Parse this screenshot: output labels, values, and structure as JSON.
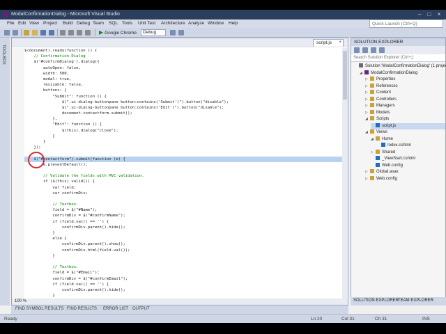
{
  "window": {
    "title": "ModalConfirmationDialog - Microsoft Visual Studio"
  },
  "menu": {
    "items": [
      "File",
      "Edit",
      "View",
      "Project",
      "Build",
      "Debug",
      "Team",
      "SQL",
      "Tools",
      "Unit Test",
      "Architecture",
      "Analyze",
      "Window",
      "Help"
    ],
    "quick_launch_placeholder": "Quick Launch (Ctrl+Q)"
  },
  "toolbar": {
    "run_label": "Google Chrome",
    "config": "Debug"
  },
  "left_panel": {
    "label": "TOOLBOX"
  },
  "editor": {
    "tab": "script.js",
    "zoom": "100 %",
    "lines": [
      {
        "t": "$(document).ready(function () {"
      },
      {
        "t": "    // Confirmation Dialog",
        "c": "c-com"
      },
      {
        "t": "    $('#confirmDialog').dialog({"
      },
      {
        "t": "        autoOpen: false,"
      },
      {
        "t": "        width: 500,"
      },
      {
        "t": "        modal: true,"
      },
      {
        "t": "        resizable: false,"
      },
      {
        "t": "        buttons: {"
      },
      {
        "t": "            \"Submit\": function () {"
      },
      {
        "t": "                $(\".ui-dialog-buttonpane button:contains('Submit')\").button(\"disable\");"
      },
      {
        "t": "                $(\".ui-dialog-buttonpane button:contains('Edit')\").button(\"disable\");"
      },
      {
        "t": "                document.contactform.submit();"
      },
      {
        "t": "            },"
      },
      {
        "t": "            \"Edit\": function () {"
      },
      {
        "t": "                $(this).dialog(\"close\");"
      },
      {
        "t": "            }"
      },
      {
        "t": "        }"
      },
      {
        "t": "    });"
      },
      {
        "t": ""
      },
      {
        "t": "    $(\"#contactform\").submit(function (e) {",
        "hl": true
      },
      {
        "t": "        e.preventDefault();"
      },
      {
        "t": ""
      },
      {
        "t": "        // Validate the fields with MVC validation.",
        "c": "c-com"
      },
      {
        "t": "        if ($(this).valid()) {"
      },
      {
        "t": "            var field;"
      },
      {
        "t": "            var confirmDiv;"
      },
      {
        "t": ""
      },
      {
        "t": "            // Textbox.",
        "c": "c-com"
      },
      {
        "t": "            field = $(\"#Name\");"
      },
      {
        "t": "            confirmDiv = $(\"#confirmName\");"
      },
      {
        "t": "            if (field.val() == '') {"
      },
      {
        "t": "                confirmDiv.parent().hide();"
      },
      {
        "t": "            }"
      },
      {
        "t": "            else {"
      },
      {
        "t": "                confirmDiv.parent().show();"
      },
      {
        "t": "                confirmDiv.html(field.val());"
      },
      {
        "t": "            }"
      },
      {
        "t": ""
      },
      {
        "t": "            // Textbox.",
        "c": "c-com"
      },
      {
        "t": "            field = $(\"#Email\");"
      },
      {
        "t": "            confirmDiv = $(\"#confirmEmail\");"
      },
      {
        "t": "            if (field.val() == '') {"
      },
      {
        "t": "                confirmDiv.parent().hide();"
      },
      {
        "t": "            }"
      }
    ]
  },
  "bottom_tabs": [
    "FIND SYMBOL RESULTS",
    "FIND RESULTS",
    "ERROR LIST",
    "OUTPUT"
  ],
  "solution_explorer": {
    "title": "SOLUTION EXPLORER",
    "search_placeholder": "Search Solution Explorer (Ctrl+;)",
    "nodes": [
      {
        "label": "Solution 'ModalConfirmationDialog' (1 project)",
        "depth": 0,
        "arrow": ""
      },
      {
        "label": "ModalConfirmationDialog",
        "depth": 1,
        "arrow": "◢"
      },
      {
        "label": "Properties",
        "depth": 2,
        "arrow": "▷"
      },
      {
        "label": "References",
        "depth": 2,
        "arrow": "▷"
      },
      {
        "label": "Content",
        "depth": 2,
        "arrow": "▷"
      },
      {
        "label": "Controllers",
        "depth": 2,
        "arrow": "▷"
      },
      {
        "label": "Managers",
        "depth": 2,
        "arrow": "▷"
      },
      {
        "label": "Models",
        "depth": 2,
        "arrow": "▷"
      },
      {
        "label": "Scripts",
        "depth": 2,
        "arrow": "◢"
      },
      {
        "label": "script.js",
        "depth": 3,
        "arrow": "",
        "sel": true
      },
      {
        "label": "Views",
        "depth": 2,
        "arrow": "◢"
      },
      {
        "label": "Home",
        "depth": 3,
        "arrow": "◢"
      },
      {
        "label": "Index.cshtml",
        "depth": 4,
        "arrow": ""
      },
      {
        "label": "Shared",
        "depth": 3,
        "arrow": "▷"
      },
      {
        "label": "_ViewStart.cshtml",
        "depth": 3,
        "arrow": ""
      },
      {
        "label": "Web.config",
        "depth": 3,
        "arrow": ""
      },
      {
        "label": "Global.asax",
        "depth": 2,
        "arrow": "▷"
      },
      {
        "label": "Web.config",
        "depth": 2,
        "arrow": "▷"
      }
    ],
    "bottom_tabs": [
      "SOLUTION EXPLORER",
      "TEAM EXPLORER"
    ]
  },
  "status": {
    "ready": "Ready",
    "ln": "Ln 20",
    "col": "Col 31",
    "ch": "Ch 31",
    "mode": "INS"
  },
  "colors": {
    "title_bar": "#2b3e5c",
    "selection": "#b8d2f0",
    "annotation_circle": "#d42a2a"
  }
}
